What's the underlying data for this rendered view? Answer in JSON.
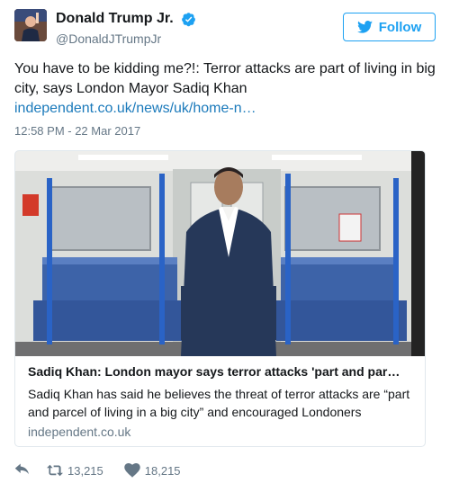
{
  "author": {
    "display_name": "Donald Trump Jr.",
    "screen_name": "@DonaldJTrumpJr",
    "verified_icon": "verified-badge-icon"
  },
  "follow": {
    "label": "Follow",
    "icon": "twitter-bird-icon",
    "color": "#1da1f2"
  },
  "tweet": {
    "text": "You have to be kidding me?!: Terror attacks are part of living in big city, says London Mayor Sadiq Khan",
    "link": "independent.co.uk/news/uk/home-n…",
    "timestamp": "12:58 PM - 22 Mar 2017"
  },
  "card": {
    "title": "Sadiq Khan: London mayor says terror attacks 'part and par…",
    "description": "Sadiq Khan has said he believes the threat of terror attacks are “part and parcel of living in a big city” and encouraged Londoners",
    "domain": "independent.co.uk"
  },
  "actions": {
    "reply_icon": "reply-icon",
    "retweet_icon": "retweet-icon",
    "retweet_count": "13,215",
    "like_icon": "heart-icon",
    "like_count": "18,215"
  },
  "colors": {
    "link": "#1b7abb",
    "muted": "#657786",
    "text": "#14171a"
  }
}
